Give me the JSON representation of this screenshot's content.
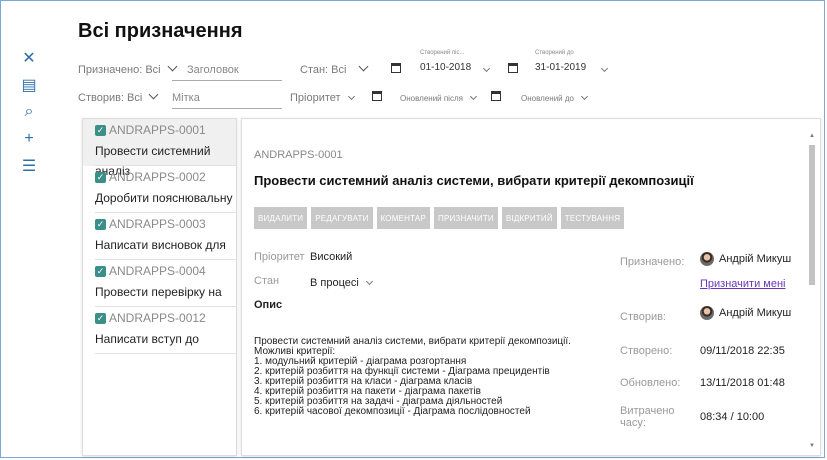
{
  "page": {
    "title": "Всі призначення"
  },
  "rail": [
    {
      "icon": "close-icon",
      "glyph": "✕"
    },
    {
      "icon": "calendar-icon",
      "glyph": "▤"
    },
    {
      "icon": "search-icon",
      "glyph": "⌕"
    },
    {
      "icon": "add-icon",
      "glyph": "+"
    },
    {
      "icon": "list-icon",
      "glyph": "☰"
    }
  ],
  "filters": {
    "assigned_label": "Призначено: Всі",
    "title_placeholder": "Заголовок",
    "state_label": "Стан: Всі",
    "created_from_caption": "Створений піс...",
    "created_from_value": "01-10-2018",
    "created_to_caption": "Створений до",
    "created_to_value": "31-01-2019",
    "created_by_label": "Створив: Всі",
    "tag_placeholder": "Мітка",
    "priority_label": "Пріоритет",
    "updated_after": "Оновлений після",
    "updated_to": "Оновлений до"
  },
  "sidebar": {
    "items": [
      {
        "id": "ANDRAPPS-0001",
        "title": "Провести системний аналіз"
      },
      {
        "id": "ANDRAPPS-0002",
        "title": "Доробити пояснювальну"
      },
      {
        "id": "ANDRAPPS-0003",
        "title": "Написати висновок для"
      },
      {
        "id": "ANDRAPPS-0004",
        "title": "Провести перевірку на"
      },
      {
        "id": "ANDRAPPS-0012",
        "title": "Написати вступ до"
      }
    ]
  },
  "task": {
    "id": "ANDRAPPS-0001",
    "title": "Провести системний аналіз системи, вибрати критерії декомпозиції",
    "buttons": [
      "ВИДАЛИТИ",
      "РЕДАГУВАТИ",
      "КОМЕНТАР",
      "ПРИЗНАЧИТИ",
      "ВІДКРИТИЙ",
      "ТЕСТУВАННЯ"
    ],
    "priority_label": "Пріоритет",
    "priority_value": "Високий",
    "state_label": "Стан",
    "state_value": "В процесі",
    "desc_label": "Опис",
    "description": "Провести системний аналіз системи, вибрати критерії декомпозиції.\nМожливі критерії:\n1. модульний критерій - діаграма розгортання\n2. критерій розбиття на функції системи - Діаграма прецидентів\n3. критерій розбиття на класи - діаграма класів\n4. критерій розбиття на пакети - діаграма пакетів\n5. критерій розбиття на задачі - діаграма діяльностей\n6. критерій часової декомпозиції - Діаграма послідовностей",
    "assigned_label": "Призначено:",
    "assigned_value": "Андрій Микуш",
    "assign_me": "Призначити мені",
    "created_by_label": "Створив:",
    "created_by_value": "Андрій Микуш",
    "created_label": "Створено:",
    "created_value": "09/11/2018 22:35",
    "updated_label": "Обновлено:",
    "updated_value": "13/11/2018 01:48",
    "spent_label": "Витрачено\nчасу:",
    "spent_value": "08:34 / 10:00"
  }
}
